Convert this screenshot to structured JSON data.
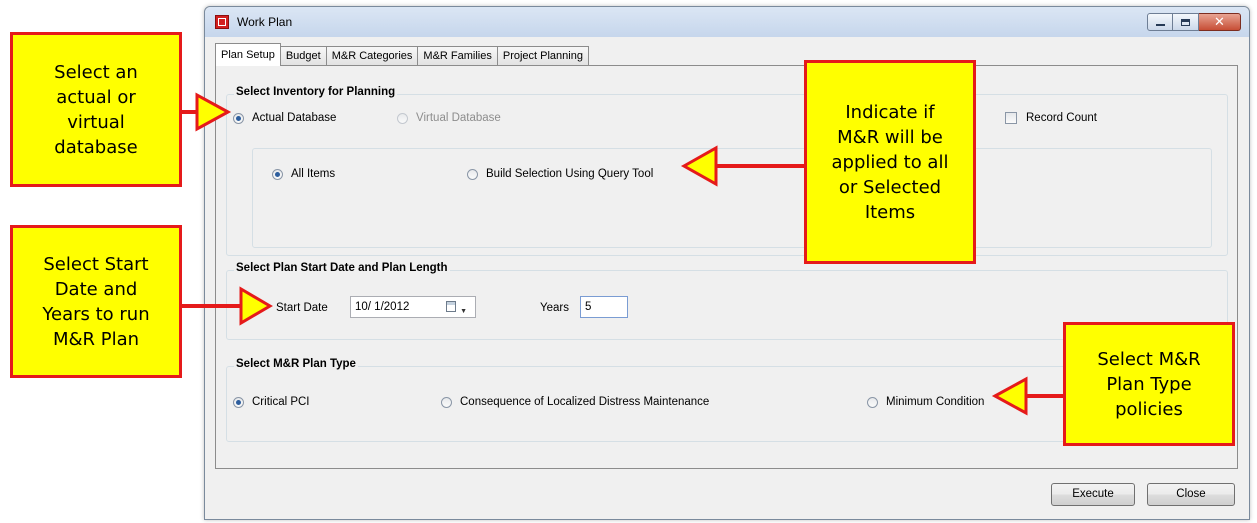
{
  "window": {
    "title": "Work Plan",
    "icon": "work-plan-app-icon"
  },
  "tabs": [
    {
      "label": "Plan Setup",
      "active": true
    },
    {
      "label": "Budget"
    },
    {
      "label": "M&R Categories"
    },
    {
      "label": "M&R Families"
    },
    {
      "label": "Project Planning"
    }
  ],
  "inventory": {
    "title": "Select Inventory for Planning",
    "actual_label": "Actual Database",
    "virtual_label": "Virtual Database",
    "record_count_label": "Record Count",
    "all_items_label": "All Items",
    "query_label": "Build Selection Using Query Tool"
  },
  "plan_dates": {
    "title": "Select Plan Start Date and Plan Length",
    "start_label": "Start Date",
    "start_value": "10/ 1/2012",
    "years_label": "Years",
    "years_value": "5"
  },
  "plan_type": {
    "title": "Select M&R Plan Type",
    "critical_label": "Critical PCI",
    "consequence_label": "Consequence of Localized Distress Maintenance",
    "minimum_label": "Minimum Condition"
  },
  "buttons": {
    "execute": "Execute",
    "close": "Close"
  },
  "callouts": {
    "database": [
      "Select an",
      "actual or",
      "virtual",
      "database"
    ],
    "items": [
      "Indicate if",
      "M&R will be",
      "applied to all",
      "or Selected",
      "Items"
    ],
    "dates": [
      "Select Start",
      "Date and",
      "Years to run",
      "M&R Plan"
    ],
    "plan_type": [
      "Select M&R",
      "Plan Type",
      "policies"
    ]
  },
  "colors": {
    "callout_fill": "#ffff00",
    "callout_border": "#e51a1a",
    "radio_selected": "#2d5e9e"
  }
}
